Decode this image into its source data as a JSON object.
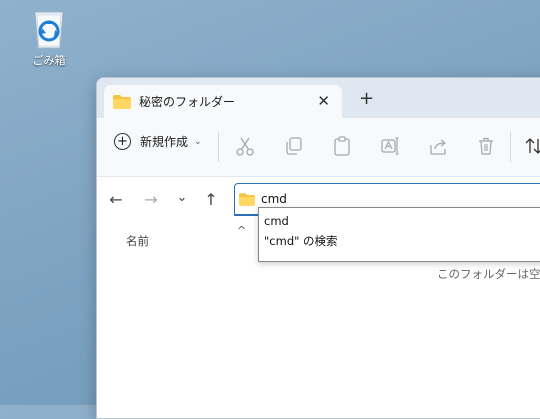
{
  "desktop": {
    "recycle_bin_label": "ごみ箱"
  },
  "window": {
    "tab_title": "秘密のフォルダー",
    "tab_close": "✕",
    "new_tab": "+"
  },
  "toolbar": {
    "new_label": "新規作成",
    "new_caret": "⌄",
    "buttons": [
      "cut-icon",
      "copy-icon",
      "paste-icon",
      "rename-icon",
      "share-icon",
      "delete-icon",
      "sort-icon"
    ]
  },
  "nav": {
    "back": "←",
    "forward": "→",
    "recent": "⌄",
    "up": "↑"
  },
  "address": {
    "value": "cmd"
  },
  "suggestions": [
    "cmd",
    "\"cmd\" の検索"
  ],
  "file_list": {
    "column_name": "名前",
    "sort_indicator": "^",
    "empty_message": "このフォルダーは空です"
  },
  "colors": {
    "accent": "#2a6fb8",
    "folder": "#f4c542",
    "desktop": "#7ea4c2"
  }
}
